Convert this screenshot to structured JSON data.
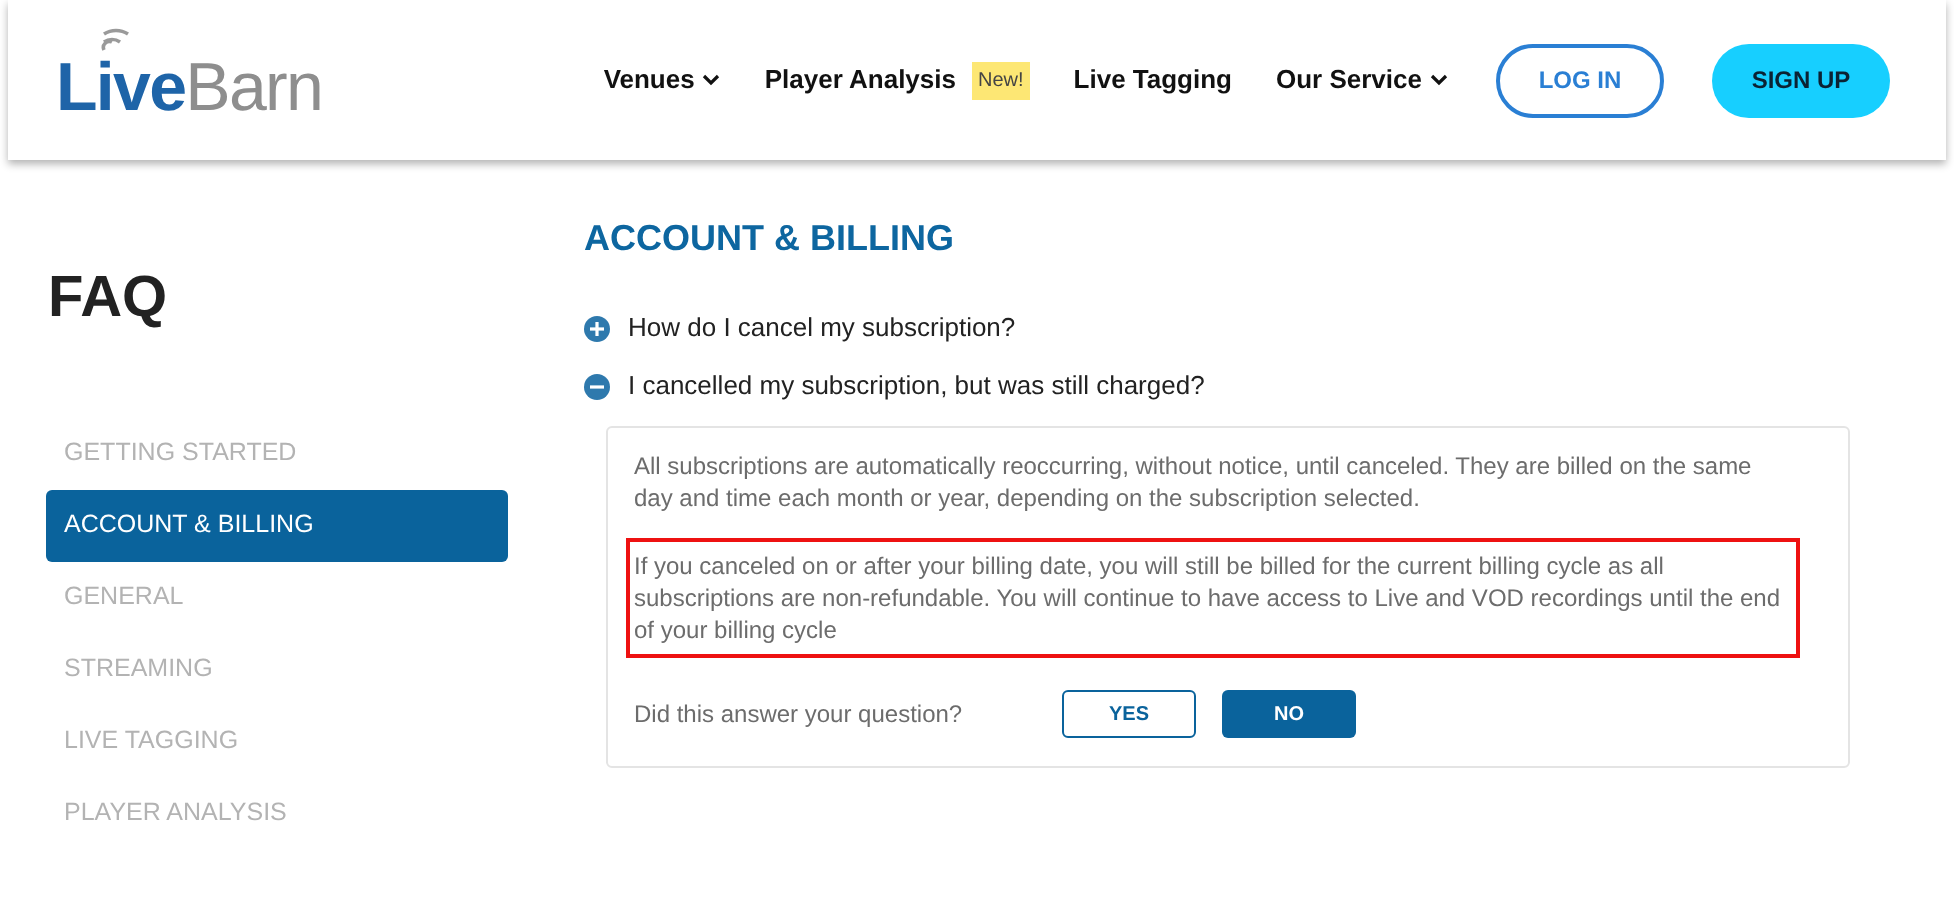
{
  "header": {
    "logo": {
      "first": "Live",
      "second": "Barn"
    },
    "nav": [
      {
        "label": "Venues",
        "dropdown": true
      },
      {
        "label": "Player Analysis",
        "dropdown": false,
        "badge": "New!"
      },
      {
        "label": "Live Tagging",
        "dropdown": false
      },
      {
        "label": "Our Service",
        "dropdown": true
      }
    ],
    "buttons": [
      {
        "kind": "outline",
        "label": "LOG IN"
      },
      {
        "kind": "filled",
        "label": "SIGN UP"
      }
    ]
  },
  "sidebar": {
    "title": "FAQ",
    "items": [
      {
        "label": "GETTING STARTED",
        "selected": false
      },
      {
        "label": "ACCOUNT & BILLING",
        "selected": true
      },
      {
        "label": "GENERAL",
        "selected": false
      },
      {
        "label": "STREAMING",
        "selected": false
      },
      {
        "label": "LIVE TAGGING",
        "selected": false
      },
      {
        "label": "PLAYER ANALYSIS",
        "selected": false
      }
    ]
  },
  "section": {
    "title": "ACCOUNT & BILLING",
    "questions": [
      {
        "question": "How do I cancel my subscription?",
        "expanded": false
      },
      {
        "question": "I cancelled my subscription, but was still charged?",
        "expanded": true,
        "answer": [
          {
            "text": "All subscriptions are automatically reoccurring, without notice, until canceled. They are billed on the same day and time each month or year, depending on the subscription selected.",
            "highlighted": false
          },
          {
            "text": "If you canceled on or after your billing date, you will still be billed for the current billing cycle as all subscriptions are non-refundable. You will continue to have access to Live and VOD recordings until the end of your billing cycle",
            "highlighted": true
          }
        ],
        "feedback": {
          "prompt": "Did this answer your question?",
          "options": [
            {
              "label": "YES",
              "selected": false
            },
            {
              "label": "NO",
              "selected": true
            }
          ]
        }
      }
    ]
  }
}
